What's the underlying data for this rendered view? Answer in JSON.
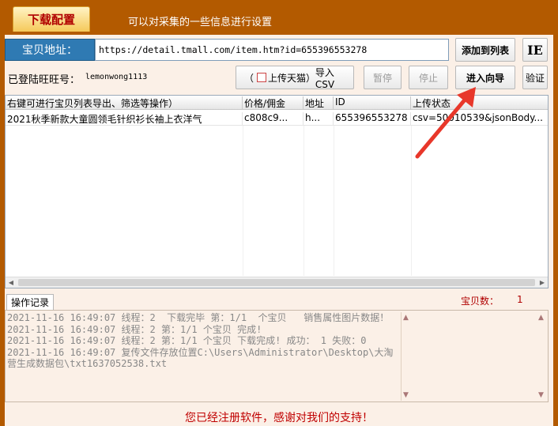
{
  "topbar": {
    "tab_label": "下载配置",
    "description": "可以对采集的一些信息进行设置"
  },
  "url_row": {
    "label": "宝贝地址：",
    "value": "https://detail.tmall.com/item.htm?id=655396553278",
    "add_button": "添加到列表",
    "ie_button": "IE"
  },
  "action_row": {
    "wang_label": "已登陆旺旺号：",
    "wang_value": "lemonwong1113",
    "paren_open": "（",
    "checkbox_label": "上传天猫）",
    "import_csv": "导入CSV",
    "pause": "暂停",
    "stop": "停止",
    "wizard": "进入向导",
    "verify": "验证"
  },
  "grid": {
    "columns": [
      "右键可进行宝贝列表导出、筛选等操作）",
      "价格/佣金",
      "地址",
      "ID",
      "上传状态"
    ],
    "rows": [
      [
        "2021秋季新款大童圆领毛针织衫长袖上衣洋气",
        "c808c9...",
        "h...",
        "655396553278",
        "csv=50010539&jsonBody..."
      ]
    ]
  },
  "log": {
    "tab_label": "操作记录",
    "count_label": "宝贝数：",
    "count_value": "1",
    "lines": "2021-11-16 16:49:07 线程：2  下载完毕 第：1/1  个宝贝   销售属性图片数据！\n2021-11-16 16:49:07 线程：2 第：1/1 个宝贝 完成!\n2021-11-16 16:49:07 线程：2 第：1/1 个宝贝 下载完成! 成功： 1 失败：0\n2021-11-16 16:49:07 复传文件存放位置C:\\Users\\Administrator\\Desktop\\大淘营生成数据包\\txt1637052538.txt"
  },
  "footer": "您已经注册软件，感谢对我们的支持！",
  "colors": {
    "accent": "#b35a00",
    "arrow": "#e8372a",
    "footer": "#c00000"
  }
}
